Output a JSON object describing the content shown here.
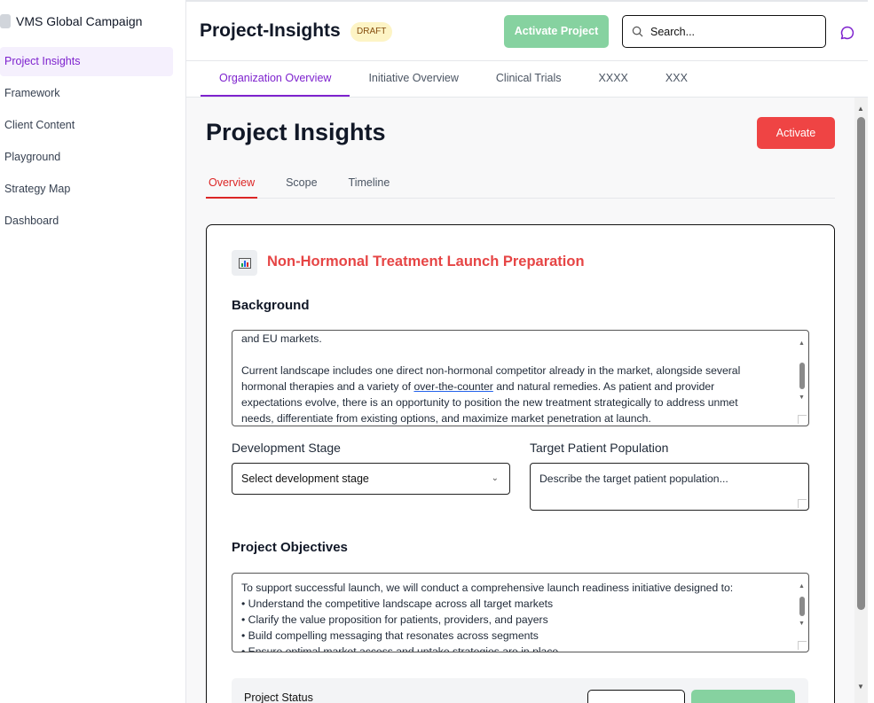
{
  "sidebar": {
    "brand": "VMS Global Campaign",
    "items": [
      {
        "label": "Project Insights",
        "active": true
      },
      {
        "label": "Framework"
      },
      {
        "label": "Client Content"
      },
      {
        "label": "Playground"
      },
      {
        "label": "Strategy Map"
      },
      {
        "label": "Dashboard"
      }
    ]
  },
  "header": {
    "title": "Project-Insights",
    "badge": "DRAFT",
    "activate_project_label": "Activate Project",
    "search_placeholder": "Search..."
  },
  "tabs": [
    {
      "label": "Organization Overview",
      "active": true
    },
    {
      "label": "Initiative Overview"
    },
    {
      "label": "Clinical Trials"
    },
    {
      "label": "XXXX"
    },
    {
      "label": "XXX"
    }
  ],
  "main": {
    "heading": "Project Insights",
    "activate_label": "Activate",
    "subtabs": [
      {
        "label": "Overview",
        "active": true
      },
      {
        "label": "Scope"
      },
      {
        "label": "Timeline"
      }
    ],
    "card": {
      "title": "Non-Hormonal Treatment Launch Preparation",
      "background_label": "Background",
      "background_lines": {
        "l0": "and EU markets.",
        "l1": "Current landscape includes one direct non-hormonal competitor already in the market, alongside several",
        "l2a": "hormonal therapies and a variety of ",
        "l2b": "over-the-counter",
        "l2c": " and natural remedies. As patient and provider",
        "l3": "expectations evolve, there is an opportunity to position the new treatment strategically to address unmet",
        "l4": "needs, differentiate from existing options, and maximize market penetration at launch."
      },
      "dev_stage_label": "Development Stage",
      "dev_stage_value": "Select development stage",
      "target_label": "Target Patient Population",
      "target_placeholder": "Describe the target patient population...",
      "objectives_label": "Project Objectives",
      "objectives_lines": [
        "To support successful launch, we will conduct a comprehensive launch readiness initiative designed to:",
        "• Understand the competitive landscape across all target markets",
        "• Clarify the value proposition for patients, providers, and payers",
        "• Build compelling messaging that resonates across segments",
        "• Ensure optimal market access and uptake strategies are in place"
      ],
      "status_label": "Project Status"
    }
  },
  "colors": {
    "accent": "#7e22ce",
    "danger": "#ef4444",
    "success": "#86d2a0"
  }
}
